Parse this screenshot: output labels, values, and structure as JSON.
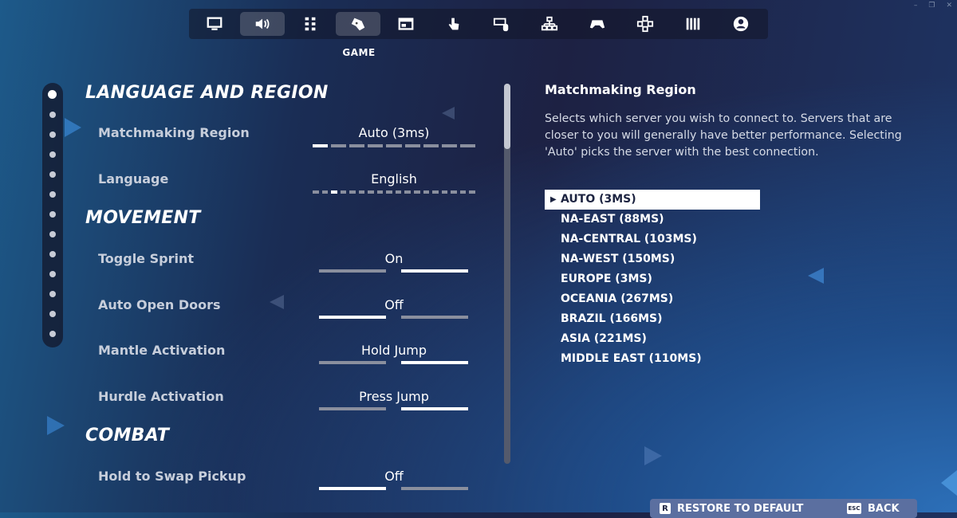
{
  "window": {
    "minimize": "–",
    "restore": "❐",
    "close": "✕"
  },
  "tabs": [
    {
      "icon": "monitor-icon",
      "active": false
    },
    {
      "icon": "speaker-icon",
      "active": false,
      "highlight": true
    },
    {
      "icon": "grid-icon",
      "active": false
    },
    {
      "icon": "game-controller-icon",
      "active": true
    },
    {
      "icon": "window-icon",
      "active": false
    },
    {
      "icon": "touch-icon",
      "active": false
    },
    {
      "icon": "keyboard-mouse-icon",
      "active": false
    },
    {
      "icon": "network-icon",
      "active": false
    },
    {
      "icon": "gamepad-icon",
      "active": false
    },
    {
      "icon": "dpad-icon",
      "active": false
    },
    {
      "icon": "piano-icon",
      "active": false
    },
    {
      "icon": "account-icon",
      "active": false
    }
  ],
  "active_tab_caption": "GAME",
  "sections": {
    "language_region": "LANGUAGE AND REGION",
    "movement": "MOVEMENT",
    "combat": "COMBAT"
  },
  "settings": {
    "matchmaking_region": {
      "label": "Matchmaking Region",
      "value": "Auto (3ms)",
      "options_count": 9,
      "selected_index": 0
    },
    "language": {
      "label": "Language",
      "value": "English",
      "options_count": 18,
      "selected_index": 2
    },
    "toggle_sprint": {
      "label": "Toggle Sprint",
      "value": "On",
      "selected_index": 1
    },
    "auto_open_doors": {
      "label": "Auto Open Doors",
      "value": "Off",
      "selected_index": 0
    },
    "mantle_activation": {
      "label": "Mantle Activation",
      "value": "Hold Jump",
      "selected_index": 1
    },
    "hurdle_activation": {
      "label": "Hurdle Activation",
      "value": "Press Jump",
      "selected_index": 1
    },
    "hold_to_swap_pickup": {
      "label": "Hold to Swap Pickup",
      "value": "Off",
      "selected_index": 0
    }
  },
  "detail": {
    "title": "Matchmaking Region",
    "description": "Selects which server you wish to connect to. Servers that are closer to you will generally have better performance. Selecting 'Auto' picks the server with the best connection.",
    "options": [
      "AUTO (3MS)",
      "NA-EAST (88MS)",
      "NA-CENTRAL (103MS)",
      "NA-WEST (150MS)",
      "EUROPE (3MS)",
      "OCEANIA (267MS)",
      "BRAZIL (166MS)",
      "ASIA (221MS)",
      "MIDDLE EAST (110MS)"
    ],
    "selected_option": 0,
    "caret": "▶"
  },
  "footer": {
    "restore_key": "R",
    "restore_label": "RESTORE TO DEFAULT",
    "back_key": "ESC",
    "back_label": "BACK"
  }
}
